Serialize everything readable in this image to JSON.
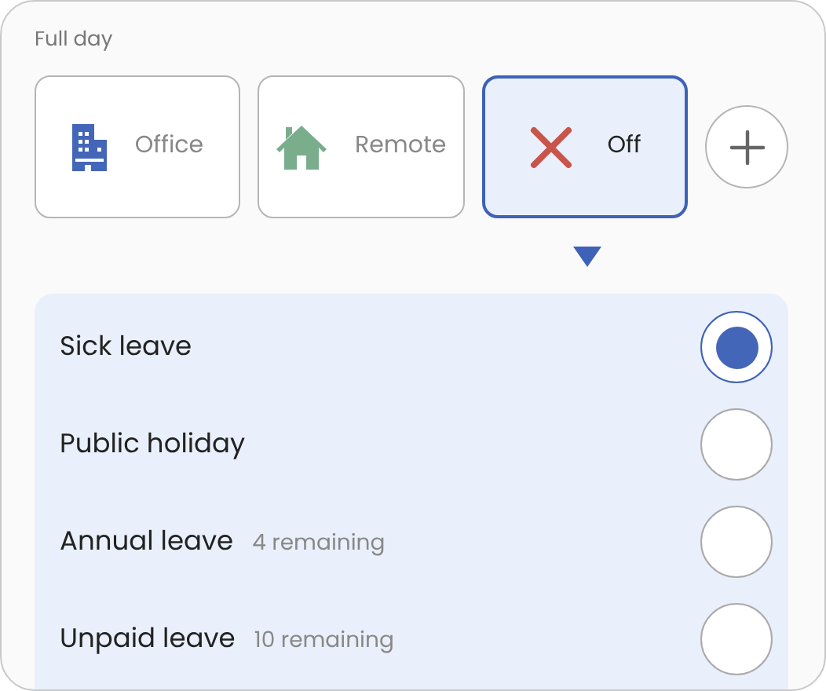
{
  "section_label": "Full day",
  "options": [
    {
      "label": "Office",
      "kind": "office",
      "selected": false
    },
    {
      "label": "Remote",
      "kind": "remote",
      "selected": false
    },
    {
      "label": "Off",
      "kind": "off",
      "selected": true
    }
  ],
  "leave_types": [
    {
      "label": "Sick leave",
      "selected": true
    },
    {
      "label": "Public holiday",
      "selected": false
    },
    {
      "label": "Annual leave",
      "note": "4 remaining",
      "selected": false
    },
    {
      "label": "Unpaid leave",
      "note": "10 remaining",
      "selected": false
    }
  ]
}
